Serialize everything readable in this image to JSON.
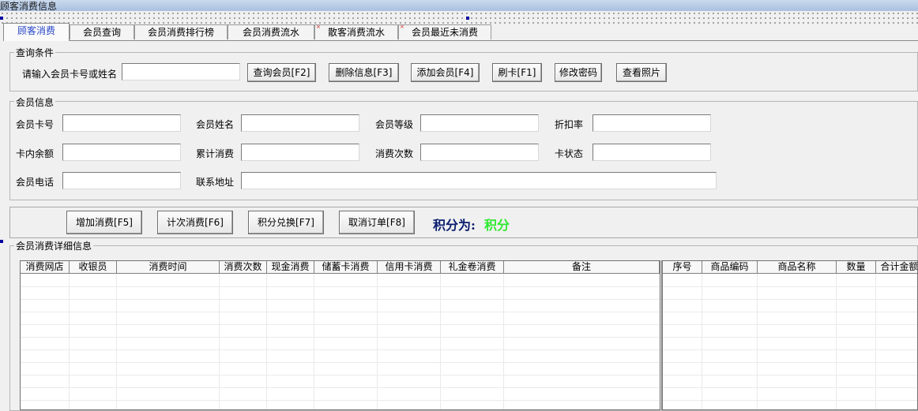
{
  "window": {
    "title": "顾客消费信息"
  },
  "tabs": [
    {
      "label": "顾客消费",
      "active": true
    },
    {
      "label": "会员查询"
    },
    {
      "label": "会员消费排行榜"
    },
    {
      "label": "会员消费流水"
    },
    {
      "label": "散客消费流水",
      "marked": true
    },
    {
      "label": "会员最近未消费",
      "marked": true
    }
  ],
  "query": {
    "group_title": "查询条件",
    "input_label": "请输入会员卡号或姓名",
    "input_value": "",
    "buttons": {
      "query": "查询会员[F2]",
      "delete": "删除信息[F3]",
      "add": "添加会员[F4]",
      "swipe": "刷卡[F1]",
      "password": "修改密码",
      "photo": "查看照片"
    }
  },
  "member": {
    "group_title": "会员信息",
    "fields": {
      "card_no": {
        "label": "会员卡号",
        "value": ""
      },
      "name": {
        "label": "会员姓名",
        "value": ""
      },
      "level": {
        "label": "会员等级",
        "value": ""
      },
      "discount": {
        "label": "折扣率",
        "value": ""
      },
      "balance": {
        "label": "卡内余额",
        "value": ""
      },
      "total": {
        "label": "累计消费",
        "value": ""
      },
      "count": {
        "label": "消费次数",
        "value": ""
      },
      "status": {
        "label": "卡状态",
        "value": ""
      },
      "phone": {
        "label": "会员电话",
        "value": ""
      },
      "address": {
        "label": "联系地址",
        "value": ""
      }
    }
  },
  "actions": {
    "add_consume": "增加消费[F5]",
    "count_consume": "计次消费[F6]",
    "points_exchange": "积分兑换[F7]",
    "cancel_order": "取消订单[F8]",
    "points_label": "积分为:",
    "points_value": "积分",
    "colors": {
      "points_label": "#0a1e6e",
      "points_value": "#2ee82e"
    }
  },
  "details": {
    "group_title": "会员消费详细信息",
    "left_columns": [
      "消费网店",
      "收银员",
      "消费时间",
      "消费次数",
      "现金消费",
      "储蓄卡消费",
      "信用卡消费",
      "礼金卷消费",
      "备注"
    ],
    "right_columns": [
      "序号",
      "商品编码",
      "商品名称",
      "数量",
      "合计金额"
    ]
  }
}
